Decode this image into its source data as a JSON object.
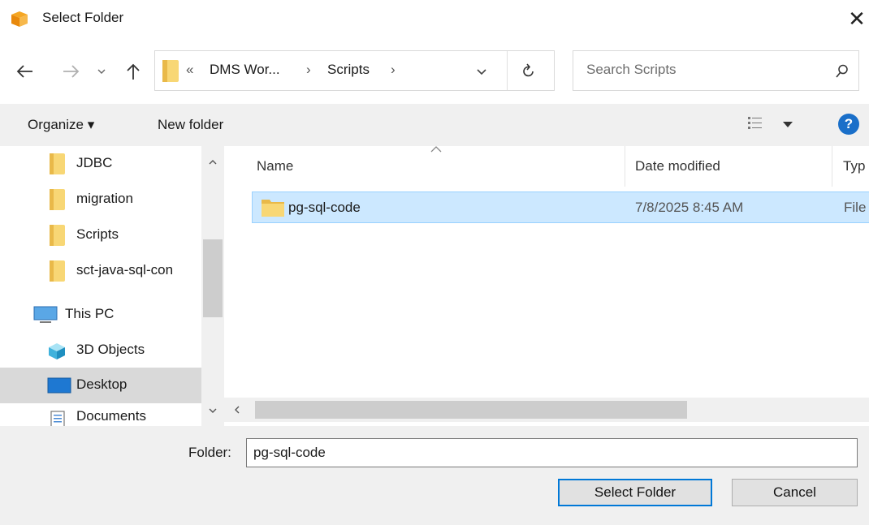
{
  "window": {
    "title": "Select Folder",
    "app_icon": "app-package-icon",
    "close_glyph": "✕"
  },
  "nav": {
    "back_icon": "arrow-left-icon",
    "forward_icon": "arrow-right-icon",
    "recent_icon": "chevron-down-icon",
    "up_icon": "arrow-up-icon",
    "breadcrumb": {
      "overflow": "«",
      "parts": [
        "DMS Wor...",
        "Scripts"
      ],
      "separator": "›"
    },
    "refresh_icon": "refresh-icon",
    "search_placeholder": "Search Scripts"
  },
  "toolbar": {
    "organize_label": "Organize ▾",
    "new_folder_label": "New folder",
    "view_icon": "view-details-icon",
    "help_glyph": "?"
  },
  "nav_pane": {
    "items": [
      {
        "label": "JDBC",
        "icon": "folder-icon",
        "selected": false
      },
      {
        "label": "migration",
        "icon": "folder-icon",
        "selected": false
      },
      {
        "label": "Scripts",
        "icon": "folder-icon",
        "selected": false
      },
      {
        "label": "sct-java-sql-con",
        "icon": "folder-icon",
        "selected": false
      },
      {
        "label": "This PC",
        "icon": "computer-icon",
        "selected": false
      },
      {
        "label": "3D Objects",
        "icon": "cube-icon",
        "selected": false
      },
      {
        "label": "Desktop",
        "icon": "desktop-icon",
        "selected": true
      },
      {
        "label": "Documents",
        "icon": "documents-icon",
        "selected": false
      }
    ]
  },
  "file_list": {
    "columns": [
      "Name",
      "Date modified",
      "Typ"
    ],
    "rows": [
      {
        "name": "pg-sql-code",
        "date_modified": "7/8/2025 8:45 AM",
        "type": "File",
        "selected": true
      }
    ]
  },
  "footer": {
    "folder_label": "Folder:",
    "folder_value": "pg-sql-code",
    "select_button": "Select Folder",
    "cancel_button": "Cancel"
  },
  "colors": {
    "selection_bg": "#cce8ff",
    "selection_border": "#99d1ff",
    "folder_yellow": "#f8d775",
    "help_blue": "#1a6fc9",
    "primary_border": "#0078d7"
  }
}
